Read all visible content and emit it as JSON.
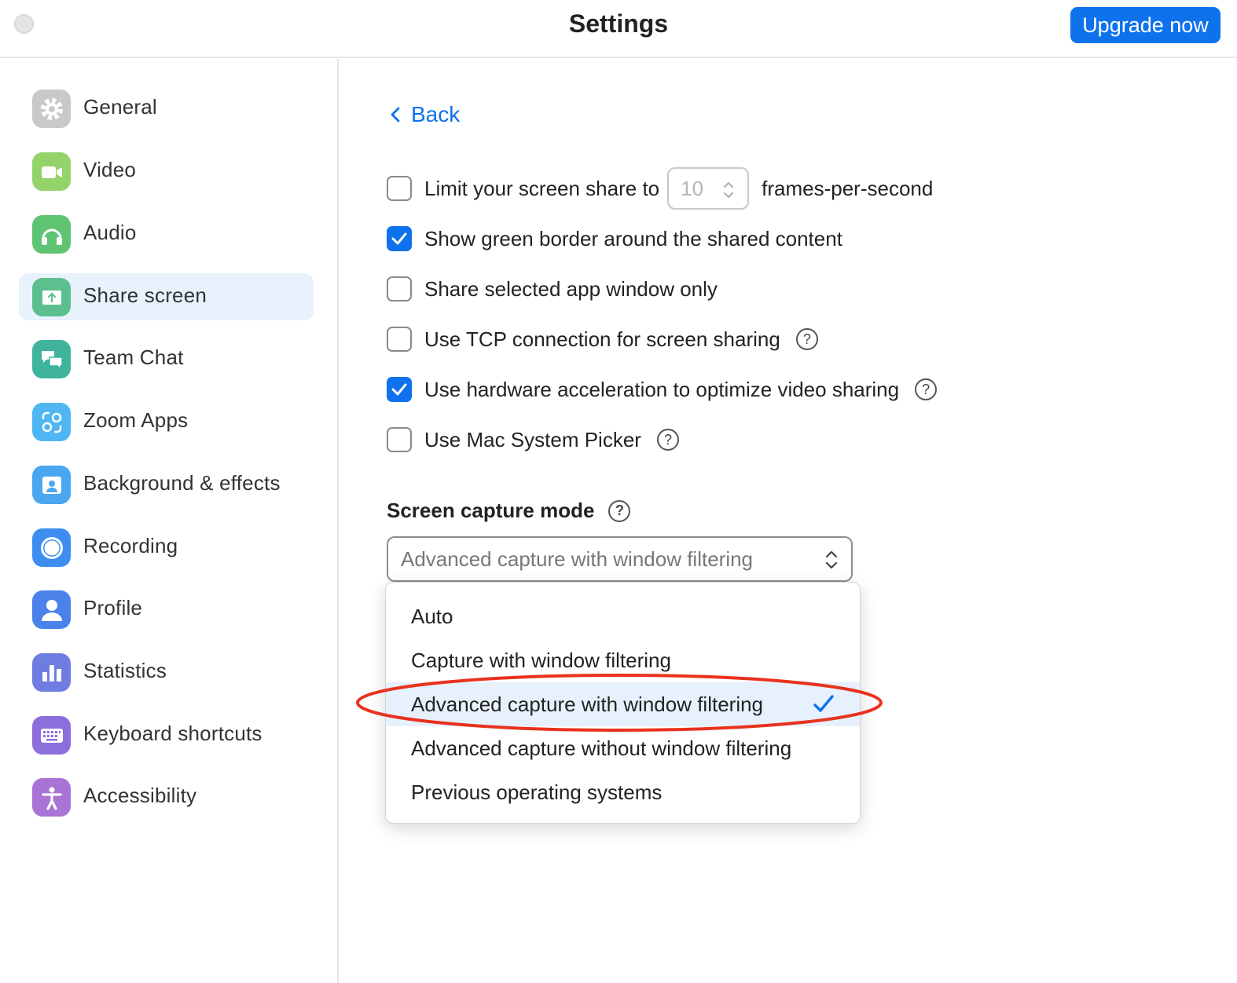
{
  "window": {
    "title": "Settings",
    "upgrade_label": "Upgrade now"
  },
  "sidebar": {
    "items": [
      {
        "label": "General",
        "icon": "gear-icon",
        "color": "#c9c9c9"
      },
      {
        "label": "Video",
        "icon": "video-camera-icon",
        "color": "#94d36a"
      },
      {
        "label": "Audio",
        "icon": "headphones-icon",
        "color": "#5fc472"
      },
      {
        "label": "Share screen",
        "icon": "share-screen-icon",
        "color": "#5cc08e"
      },
      {
        "label": "Team Chat",
        "icon": "chat-bubbles-icon",
        "color": "#3fb39c"
      },
      {
        "label": "Zoom Apps",
        "icon": "zoom-apps-icon",
        "color": "#4fb6f3"
      },
      {
        "label": "Background & effects",
        "icon": "background-person-icon",
        "color": "#4aa6ef"
      },
      {
        "label": "Recording",
        "icon": "record-icon",
        "color": "#3e8ef2"
      },
      {
        "label": "Profile",
        "icon": "profile-person-icon",
        "color": "#4a82ea"
      },
      {
        "label": "Statistics",
        "icon": "bar-chart-icon",
        "color": "#6f7de0"
      },
      {
        "label": "Keyboard shortcuts",
        "icon": "keyboard-icon",
        "color": "#8c6fdc"
      },
      {
        "label": "Accessibility",
        "icon": "accessibility-icon",
        "color": "#a974d6"
      }
    ],
    "active_index": 3
  },
  "main": {
    "back_label": "Back",
    "options": [
      {
        "label": "Limit your screen share to",
        "checked": false
      },
      {
        "label": "Show green border around the shared content",
        "checked": true
      },
      {
        "label": "Share selected app window only",
        "checked": false
      },
      {
        "label": "Use TCP connection for screen sharing",
        "checked": false,
        "help": true
      },
      {
        "label": "Use hardware acceleration to optimize video sharing",
        "checked": true,
        "help": true
      },
      {
        "label": "Use Mac System Picker",
        "checked": false,
        "help": true
      }
    ],
    "fps": {
      "value": "10",
      "suffix": "frames-per-second"
    },
    "capture_mode": {
      "title": "Screen capture mode",
      "selected": "Advanced capture with window filtering",
      "options": [
        "Auto",
        "Capture with window filtering",
        "Advanced capture with window filtering",
        "Advanced capture without window filtering",
        "Previous operating systems"
      ],
      "selected_index": 2
    },
    "help_glyph": "?"
  },
  "colors": {
    "accent": "#0e72ed",
    "annotation": "#e8321e"
  }
}
